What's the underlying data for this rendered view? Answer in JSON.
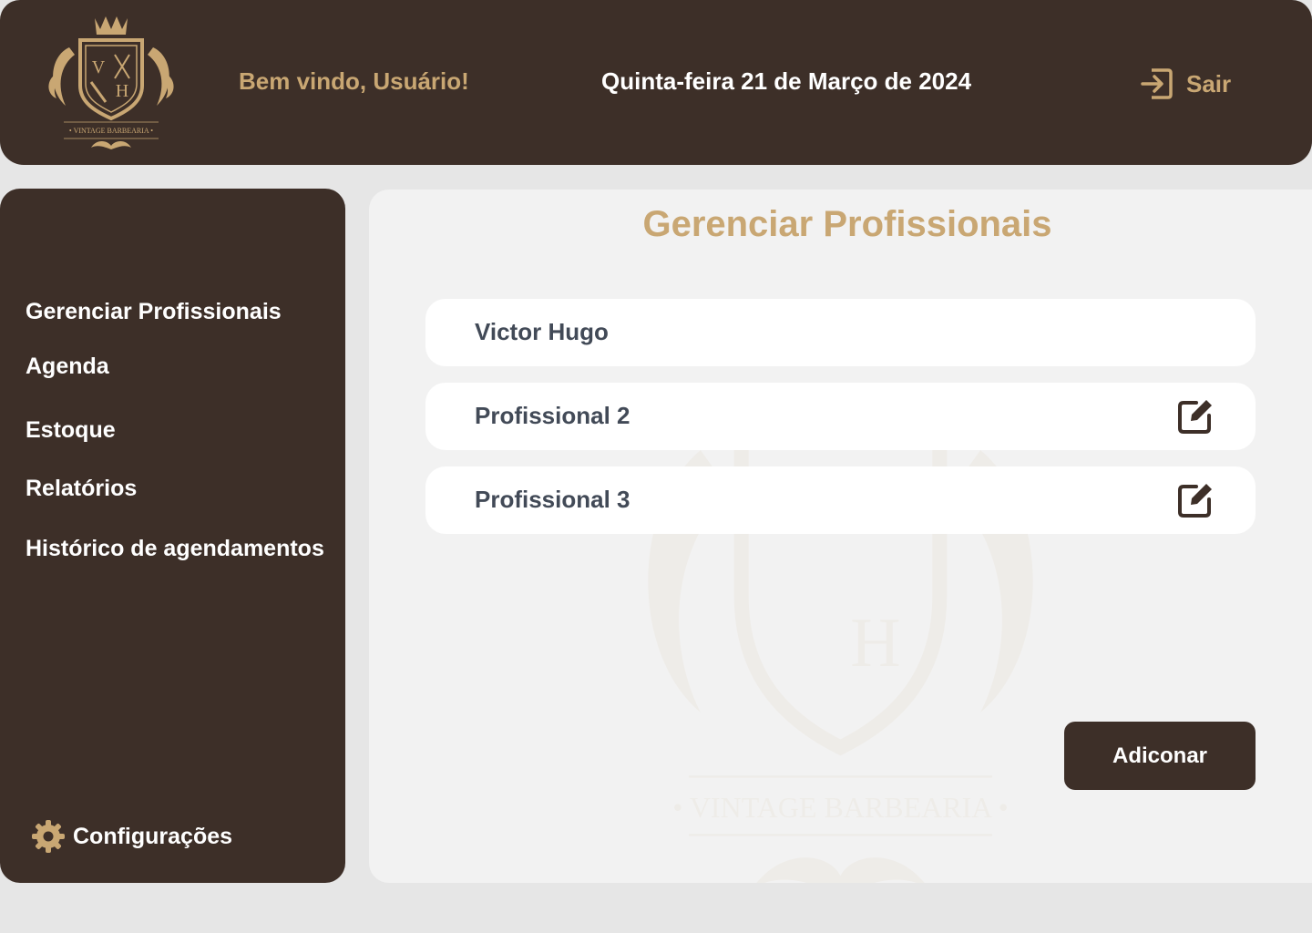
{
  "header": {
    "logo_text": "Vintage Barbearia",
    "logo_letters": [
      "V",
      "H"
    ],
    "welcome": "Bem vindo, Usuário!",
    "date": "Quinta-feira 21 de Março de 2024",
    "logout_label": "Sair",
    "logout_icon": "logout-icon"
  },
  "sidebar": {
    "items": [
      {
        "label": "Gerenciar Profissionais"
      },
      {
        "label": "Agenda"
      },
      {
        "label": "Estoque"
      },
      {
        "label": "Relatórios"
      },
      {
        "label": "Histórico de agendamentos"
      }
    ],
    "settings_label": "Configurações",
    "settings_icon": "gear-icon"
  },
  "main": {
    "title": "Gerenciar Profissionais",
    "professionals": [
      {
        "name": "Victor Hugo",
        "editable": false
      },
      {
        "name": "Profissional 2",
        "editable": true
      },
      {
        "name": "Profissional 3",
        "editable": true
      }
    ],
    "add_label": "Adiconar"
  },
  "colors": {
    "brand_dark": "#3d2f28",
    "accent_gold": "#c9a773",
    "background": "#e6e6e6",
    "panel": "#f2f2f2",
    "row_text": "#424a57"
  }
}
